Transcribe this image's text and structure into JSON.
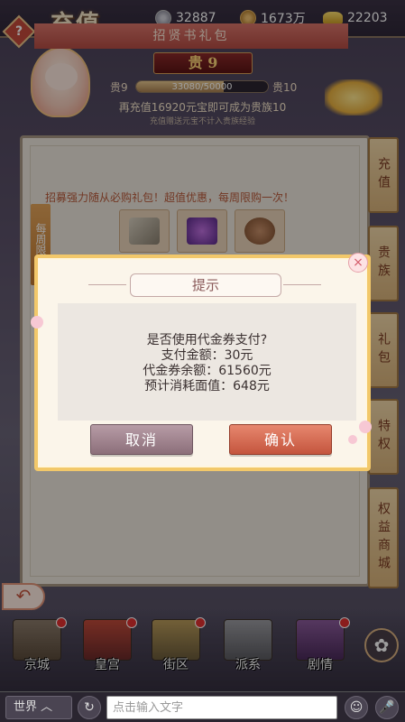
{
  "topbar": {
    "help_glyph": "?",
    "title": "充值",
    "jade": "32887",
    "coins": "1673万",
    "ingots": "22203"
  },
  "vip": {
    "banner": "贵 9",
    "level_left": "贵9",
    "level_right": "贵10",
    "progress_text": "33080/50000",
    "progress_fraction": 0.6616,
    "message": "再充值16920元宝即可成为贵族10",
    "sub_message": "充值赠送元宝不计入贵族经验"
  },
  "panel": {
    "pack_title": "招贤书礼包",
    "pack_desc": "招募强力随从必购礼包！超值优惠，每周限购一次！",
    "weekly_tag": "每周限购"
  },
  "side_tabs": [
    "充值",
    "贵族",
    "礼包",
    "特权",
    "权益商城"
  ],
  "dialog": {
    "title": "提示",
    "line1": "是否使用代金券支付?",
    "line2": "支付金额：30元",
    "line3": "代金券余额：61560元",
    "line4": "预计消耗面值：648元",
    "cancel_label": "取消",
    "confirm_label": "确认",
    "close_glyph": "×"
  },
  "back_glyph": "↶",
  "nav": [
    {
      "label": "京城"
    },
    {
      "label": "皇宫"
    },
    {
      "label": "街区"
    },
    {
      "label": "派系"
    },
    {
      "label": "剧情"
    }
  ],
  "flower_glyph": "✿",
  "chat": {
    "channel": "世界 ︿",
    "history_glyph": "↻",
    "placeholder": "点击输入文字",
    "emoji_glyph": "☺",
    "mic_glyph": "🎤"
  },
  "colors": {
    "confirm": "#c4553e",
    "cancel": "#8c6f7a",
    "dialog_border": "#f2c86a"
  }
}
